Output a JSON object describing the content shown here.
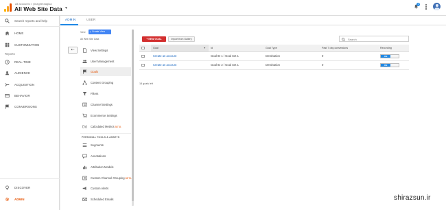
{
  "header": {
    "account_line": "All accounts > yinagheraagiua",
    "property_title": "All Web Site Data",
    "notification_count": "1"
  },
  "leftnav": {
    "search_placeholder": "Search reports and help",
    "items_top": [
      {
        "label": "HOME",
        "icon": "home-icon"
      },
      {
        "label": "CUSTOMIZATION",
        "icon": "dashboard-icon"
      }
    ],
    "reports_heading": "Reports",
    "report_items": [
      {
        "label": "REAL-TIME",
        "icon": "clock-icon"
      },
      {
        "label": "AUDIENCE",
        "icon": "person-icon"
      },
      {
        "label": "ACQUISITION",
        "icon": "acquisition-icon"
      },
      {
        "label": "BEHAVIOR",
        "icon": "behavior-icon"
      },
      {
        "label": "CONVERSIONS",
        "icon": "flag-icon"
      }
    ],
    "bottom_items": [
      {
        "label": "DISCOVER",
        "icon": "lightbulb-icon"
      },
      {
        "label": "ADMIN",
        "icon": "gear-icon"
      }
    ]
  },
  "tabs": {
    "admin": "ADMIN",
    "user": "USER"
  },
  "view_panel": {
    "view_label": "View",
    "create_view": "Create View",
    "view_name": "All Web Site Data",
    "menu": [
      {
        "label": "View Settings",
        "icon": "file-icon"
      },
      {
        "label": "User Management",
        "icon": "users-icon"
      },
      {
        "label": "Goals",
        "icon": "flag-icon"
      },
      {
        "label": "Content Grouping",
        "icon": "grouping-icon"
      },
      {
        "label": "Filters",
        "icon": "filter-icon"
      },
      {
        "label": "Channel Settings",
        "icon": "channel-icon"
      },
      {
        "label": "Ecommerce Settings",
        "icon": "cart-icon"
      },
      {
        "label": "Calculated Metrics",
        "beta": "BETA",
        "icon": "calc-icon"
      }
    ],
    "section_heading": "PERSONAL TOOLS & ASSETS",
    "personal_menu": [
      {
        "label": "Segments",
        "icon": "segments-icon"
      },
      {
        "label": "Annotations",
        "icon": "annotation-icon"
      },
      {
        "label": "Attribution Models",
        "icon": "chart-icon"
      },
      {
        "label": "Custom Channel Grouping",
        "beta": "BETA",
        "icon": "channel-icon"
      },
      {
        "label": "Custom Alerts",
        "icon": "megaphone-icon"
      },
      {
        "label": "Scheduled Emails",
        "icon": "email-icon"
      }
    ]
  },
  "goals": {
    "new_goal": "+ NEW GOAL",
    "import_gallery": "Import from Gallery",
    "search_placeholder": "Search",
    "columns": [
      "Goal",
      "Id",
      "Goal Type",
      "Past 7 day conversions",
      "Recording"
    ],
    "rows": [
      {
        "goal": "Create an account",
        "id": "Goal ID 1 / Goal Set 1",
        "type": "Destination",
        "conversions": "0",
        "recording": "ON"
      },
      {
        "goal": "Create an account",
        "id": "Goal ID 2 / Goal Set 1",
        "type": "Destination",
        "conversions": "0",
        "recording": "ON"
      }
    ],
    "goals_left": "18 goals left"
  },
  "watermark": "shirazsun.ir",
  "colors": {
    "accent_orange": "#e65100",
    "link_blue": "#1565c0",
    "new_goal_red": "#d32f2f",
    "toggle_blue": "#1e88e5"
  }
}
